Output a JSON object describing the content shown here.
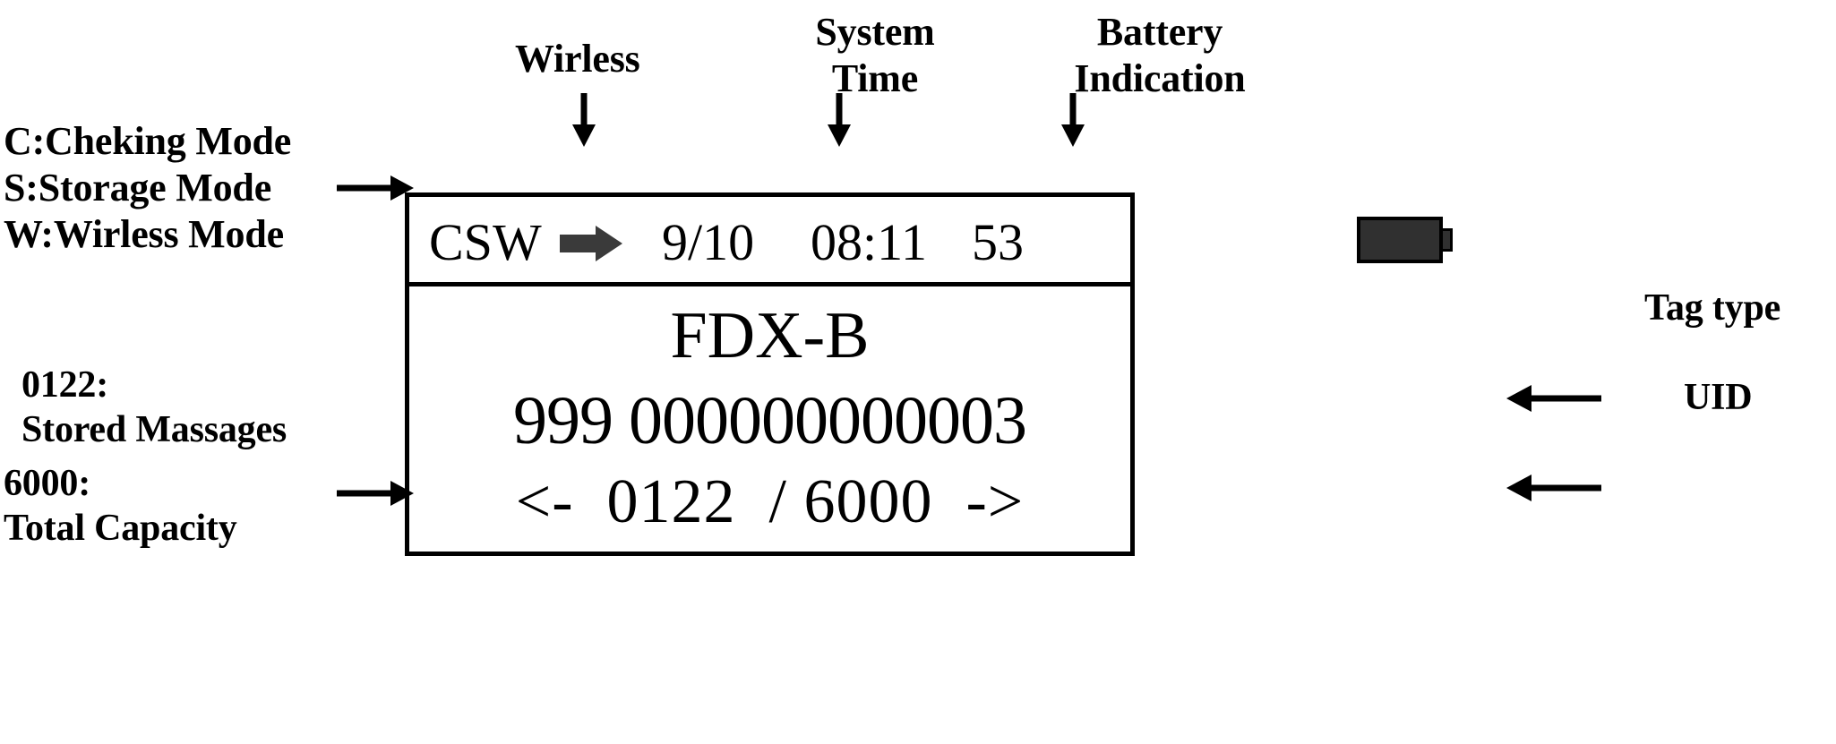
{
  "diagram": {
    "title": "RFID reader display annotation diagram",
    "callouts": {
      "modes": "C:Cheking Mode\nS:Storage Mode\nW:Wirless Mode",
      "wireless": "Wirless",
      "system_time": "System\nTime",
      "battery_indication": "Battery\nIndication",
      "tag_type": "Tag type",
      "uid": "UID",
      "stored_messages": "0122:\nStored Massages",
      "total_capacity": "6000:\nTotal Capacity"
    },
    "arrows": {
      "modes_arrow": "arrow-right-icon",
      "wireless_arrow": "arrow-down-icon",
      "system_time_arrow": "arrow-down-icon",
      "battery_arrow": "arrow-down-icon",
      "tag_type_arrow": "arrow-left-icon",
      "uid_arrow": "arrow-left-icon",
      "capacity_arrow": "arrow-right-icon"
    }
  },
  "device": {
    "status_bar": {
      "mode": "CSW",
      "wireless_icon": "arrow-right-solid-icon",
      "date": "9/10",
      "time": "08:11",
      "battery_percent": "53",
      "battery_icon": "battery-full-icon"
    },
    "screen": {
      "tag_type": "FDX-B",
      "uid": "999 000000000003",
      "page_nav": "<-  0122  / 6000  ->",
      "current_record": "0122",
      "total_capacity": "6000",
      "prev_icon": "arrow-left-ascii-icon",
      "next_icon": "arrow-right-ascii-icon"
    }
  },
  "colors": {
    "ink": "#000000",
    "background": "#ffffff",
    "battery_fill": "#303030",
    "wireless_arrow_fill": "#3a3a3a"
  }
}
